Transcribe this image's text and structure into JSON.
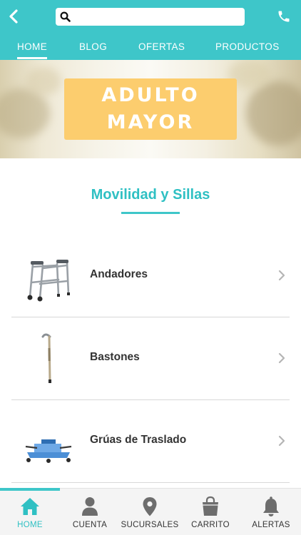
{
  "header": {
    "search": {
      "value": "",
      "placeholder": ""
    }
  },
  "tabs": [
    {
      "label": "HOME",
      "active": true
    },
    {
      "label": "BLOG"
    },
    {
      "label": "OFERTAS"
    },
    {
      "label": "PRODUCTOS"
    }
  ],
  "hero": {
    "line1": "ADULTO",
    "line2": "MAYOR"
  },
  "section": {
    "title": "Movilidad y Sillas"
  },
  "items": [
    {
      "label": "Andadores",
      "icon": "walker-icon"
    },
    {
      "label": "Bastones",
      "icon": "cane-icon"
    },
    {
      "label": "Grúas de Traslado",
      "icon": "patient-lift-icon"
    }
  ],
  "bottom_nav": [
    {
      "label": "HOME",
      "icon": "home-icon",
      "active": true
    },
    {
      "label": "CUENTA",
      "icon": "user-icon"
    },
    {
      "label": "SUCURSALES",
      "icon": "location-pin-icon"
    },
    {
      "label": "CARRITO",
      "icon": "shopping-bag-icon"
    },
    {
      "label": "ALERTAS",
      "icon": "bell-icon"
    }
  ],
  "colors": {
    "brand": "#3ec6c9",
    "accent_text": "#2fc0c3",
    "banner": "#fccd6e",
    "icon_gray": "#6d6d6d"
  }
}
